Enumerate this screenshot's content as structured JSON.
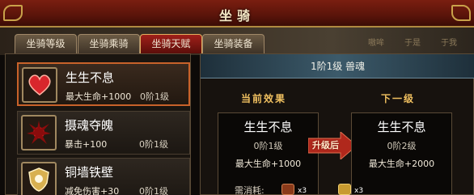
{
  "window": {
    "title": "坐骑"
  },
  "tabs": [
    {
      "label": "坐骑等级"
    },
    {
      "label": "坐骑乘骑"
    },
    {
      "label": "坐骑天赋"
    },
    {
      "label": "坐骑装备"
    }
  ],
  "background_text": [
    "嗷哞",
    "于是",
    "于我"
  ],
  "talents": [
    {
      "name": "生生不息",
      "attr": "最大生命+1000",
      "level": "0阶1级",
      "icon": "heart-icon"
    },
    {
      "name": "摄魂夺魄",
      "attr": "暴击+100",
      "level": "0阶1级",
      "icon": "blood-splash-icon"
    },
    {
      "name": "铜墙铁壁",
      "attr": "减免伤害+30",
      "level": "0阶1级",
      "icon": "shield-icon"
    }
  ],
  "detail": {
    "header": "1阶1级    兽魂",
    "current_title": "当前效果",
    "next_title": "下一级",
    "upgrade_label": "升级后",
    "current": {
      "name": "生生不息",
      "level": "0阶1级",
      "attr": "最大生命+1000"
    },
    "next": {
      "name": "生生不息",
      "level": "0阶2级",
      "attr": "最大生命+2000"
    },
    "cost_label": "需消耗:",
    "cost_items": [
      {
        "count": "x3",
        "icon": "item-icon"
      },
      {
        "count": "x3",
        "icon": "gold-ingot-icon"
      }
    ]
  },
  "colors": {
    "accent_red": "#a0201a",
    "gold": "#f0c060",
    "selected_border": "#c8622a"
  }
}
